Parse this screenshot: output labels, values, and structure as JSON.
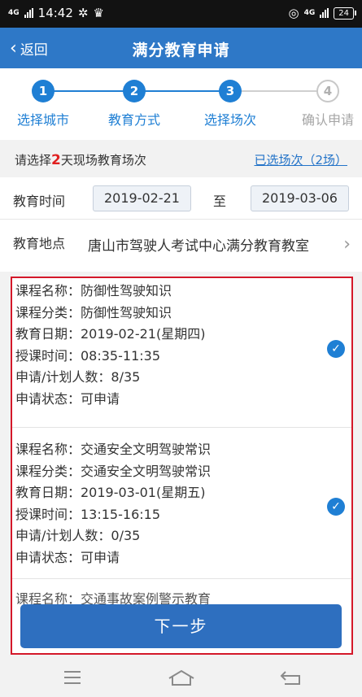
{
  "status_bar": {
    "network": "4G",
    "time": "14:42",
    "net_right": "4G",
    "battery": "24"
  },
  "header": {
    "back_label": "返回",
    "title": "满分教育申请"
  },
  "steps": [
    {
      "num": "1",
      "label": "选择城市",
      "state": "done"
    },
    {
      "num": "2",
      "label": "教育方式",
      "state": "done"
    },
    {
      "num": "3",
      "label": "选择场次",
      "state": "active"
    },
    {
      "num": "4",
      "label": "确认申请",
      "state": "pending"
    }
  ],
  "info": {
    "prefix": "请选择",
    "days": "2",
    "suffix": "天现场教育场次",
    "selected_link": "已选场次（2场）"
  },
  "date_filter": {
    "label": "教育时间",
    "start": "2019-02-21",
    "separator": "至",
    "end": "2019-03-06"
  },
  "location": {
    "label": "教育地点",
    "value": "唐山市驾驶人考试中心满分教育教室"
  },
  "courses": [
    {
      "lines": [
        "课程名称：防御性驾驶知识",
        "课程分类：防御性驾驶知识",
        "教育日期：2019-02-21(星期四)",
        "授课时间：08:35-11:35",
        "申请/计划人数：8/35",
        "申请状态：可申请"
      ],
      "selected": true
    },
    {
      "lines": [
        "课程名称：交通安全文明驾驶常识",
        "课程分类：交通安全文明驾驶常识",
        "教育日期：2019-03-01(星期五)",
        "授课时间：13:15-16:15",
        "申请/计划人数：0/35",
        "申请状态：可申请"
      ],
      "selected": true
    },
    {
      "lines": [
        "课程名称：交通事故案例警示教育"
      ],
      "selected": false
    }
  ],
  "next_button": "下一步",
  "colors": {
    "primary": "#2e78c7",
    "step_blue": "#1f7fd4",
    "highlight_red": "#d4182a",
    "button_blue": "#2e6fbf"
  },
  "icons": {
    "back": "chevron-left-icon",
    "check": "check-circle-icon",
    "arrow": "chevron-right-icon",
    "nav": [
      "menu-icon",
      "home-icon",
      "back-icon"
    ]
  }
}
